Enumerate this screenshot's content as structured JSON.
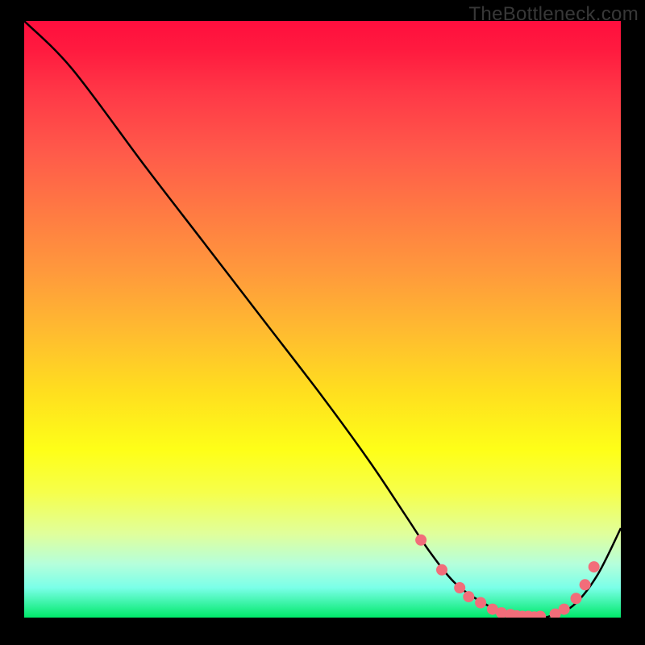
{
  "watermark": "TheBottleneck.com",
  "colors": {
    "bg": "#000000",
    "curve": "#000000",
    "marker": "#f26d7a",
    "watermark_text": "#383838"
  },
  "chart_data": {
    "type": "line",
    "title": "",
    "xlabel": "",
    "ylabel": "",
    "xlim": [
      0,
      100
    ],
    "ylim": [
      0,
      100
    ],
    "x": [
      0,
      8,
      20,
      30,
      40,
      50,
      58,
      64,
      68,
      72,
      76,
      80,
      84,
      86,
      88,
      92,
      96,
      100
    ],
    "y": [
      100,
      92,
      76,
      63,
      50,
      37,
      26,
      17,
      11,
      6,
      3,
      1,
      0,
      0,
      0.2,
      2,
      7,
      15
    ],
    "markers": [
      {
        "x": 66.5,
        "y": 13
      },
      {
        "x": 70,
        "y": 8
      },
      {
        "x": 73,
        "y": 5
      },
      {
        "x": 74.5,
        "y": 3.5
      },
      {
        "x": 76.5,
        "y": 2.5
      },
      {
        "x": 78.5,
        "y": 1.4
      },
      {
        "x": 80,
        "y": 0.8
      },
      {
        "x": 81.5,
        "y": 0.5
      },
      {
        "x": 82.5,
        "y": 0.3
      },
      {
        "x": 83.5,
        "y": 0.2
      },
      {
        "x": 84.5,
        "y": 0.2
      },
      {
        "x": 85.5,
        "y": 0.1
      },
      {
        "x": 86.5,
        "y": 0.2
      },
      {
        "x": 89,
        "y": 0.6
      },
      {
        "x": 90.5,
        "y": 1.4
      },
      {
        "x": 92.5,
        "y": 3.2
      },
      {
        "x": 94,
        "y": 5.5
      },
      {
        "x": 95.5,
        "y": 8.5
      }
    ]
  }
}
